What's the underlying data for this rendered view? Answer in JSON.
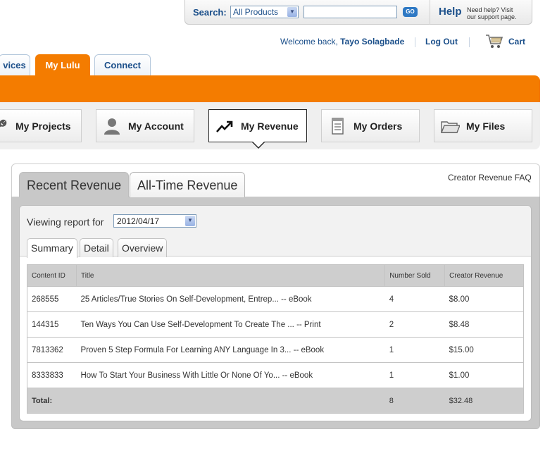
{
  "search": {
    "label": "Search:",
    "scope_value": "All Products",
    "input_value": "",
    "go_label": "GO"
  },
  "help": {
    "label": "Help",
    "text_line1": "Need help? Visit",
    "text_line2": "our support page."
  },
  "user": {
    "welcome_prefix": "Welcome back,",
    "name": "Tayo Solagbade",
    "logout_label": "Log Out",
    "cart_label": "Cart"
  },
  "main_tabs": [
    {
      "label": "vices"
    },
    {
      "label": "My Lulu"
    },
    {
      "label": "Connect"
    }
  ],
  "subnav": [
    {
      "label": "My Projects",
      "icon": "wrench-icon"
    },
    {
      "label": "My Account",
      "icon": "user-icon"
    },
    {
      "label": "My Revenue",
      "icon": "trend-up-icon"
    },
    {
      "label": "My Orders",
      "icon": "order-list-icon"
    },
    {
      "label": "My Files",
      "icon": "folder-icon"
    }
  ],
  "revenue": {
    "tabs": [
      {
        "label": "Recent Revenue"
      },
      {
        "label": "All-Time Revenue"
      }
    ],
    "faq_label": "Creator Revenue FAQ",
    "viewing_label": "Viewing report for",
    "date_value": "2012/04/17",
    "subtabs": [
      {
        "label": "Summary"
      },
      {
        "label": "Detail"
      },
      {
        "label": "Overview"
      }
    ],
    "table": {
      "headers": [
        "Content ID",
        "Title",
        "Number Sold",
        "Creator Revenue"
      ],
      "rows": [
        {
          "id": "268555",
          "title": "25 Articles/True Stories On Self-Development, Entrep... -- eBook",
          "sold": "4",
          "revenue": "$8.00"
        },
        {
          "id": "144315",
          "title": "Ten Ways You Can Use Self-Development To Create The ... -- Print",
          "sold": "2",
          "revenue": "$8.48"
        },
        {
          "id": "7813362",
          "title": "Proven 5 Step Formula For Learning ANY Language In 3... -- eBook",
          "sold": "1",
          "revenue": "$15.00"
        },
        {
          "id": "8333833",
          "title": "How To Start Your Business With Little Or None Of Yo... -- eBook",
          "sold": "1",
          "revenue": "$1.00"
        }
      ],
      "total": {
        "label": "Total:",
        "sold": "8",
        "revenue": "$32.48"
      }
    }
  },
  "colors": {
    "accent": "#f47c00",
    "link": "#1b4f8a"
  }
}
